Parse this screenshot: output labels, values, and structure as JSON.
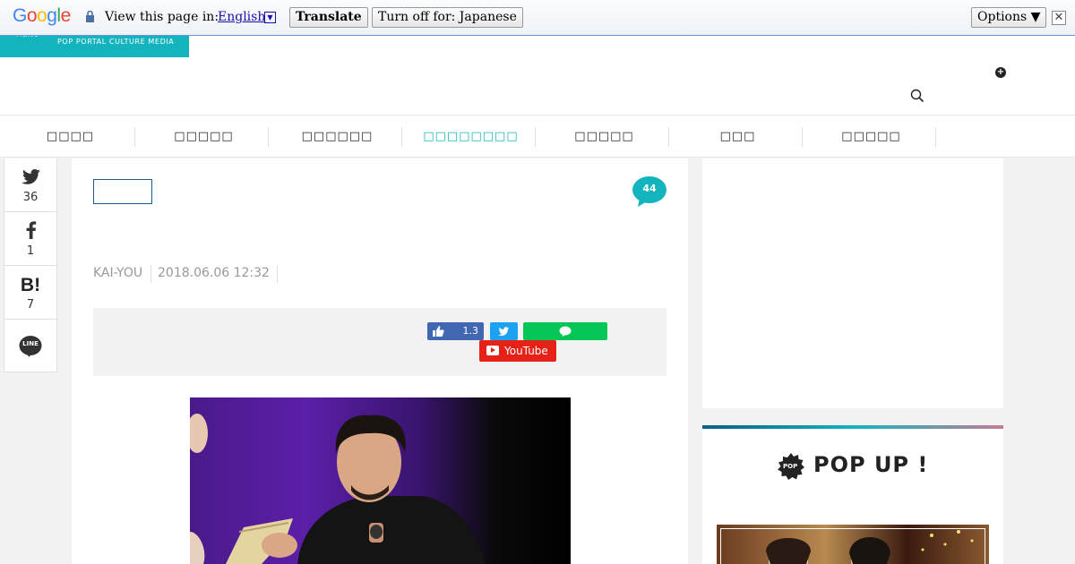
{
  "translate_bar": {
    "logo": "Google",
    "prompt": "View this page in:",
    "language": "English",
    "translate_label": "Translate",
    "turn_off_label": "Turn off for: Japanese",
    "options_label": "Options ▼",
    "close_glyph": "✕"
  },
  "header": {
    "menu_label": "MENU",
    "tagline": "POP PORTAL CULTURE MEDIA"
  },
  "nav": {
    "items": [
      {
        "label": "□□□□"
      },
      {
        "label": "□□□□□"
      },
      {
        "label": "□□□□□□"
      },
      {
        "label": "□□□□□□□□"
      },
      {
        "label": "□□□□□"
      },
      {
        "label": "□□□"
      },
      {
        "label": "□□□□□"
      }
    ],
    "active_index": 3
  },
  "share": {
    "twitter_count": "36",
    "facebook_count": "1",
    "hatena_label": "B!",
    "hatena_count": "7",
    "line_label": "LINE"
  },
  "article": {
    "comment_count": "44",
    "author": "KAI-YOU",
    "date": "2018.06.06 12:32",
    "follow": {
      "fb_like_count": "1.3",
      "youtube_label": "YouTube"
    }
  },
  "sidebar": {
    "popup_badge": "POP",
    "popup_title": "POP UP !"
  },
  "colors": {
    "brand": "#14b4be",
    "facebook": "#4267b2",
    "twitter": "#1da1f2",
    "line": "#06c755",
    "youtube": "#e62117"
  }
}
